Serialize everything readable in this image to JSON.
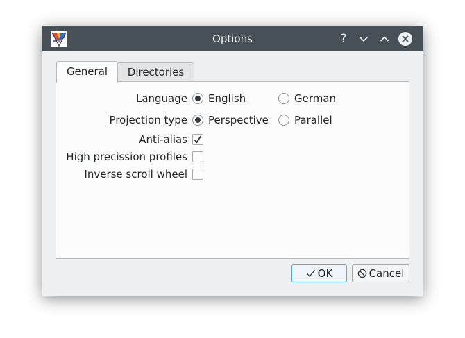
{
  "window": {
    "title": "Options"
  },
  "titlebar": {
    "help_label": "?",
    "icons": [
      "app-icon",
      "help-icon",
      "minimize-icon",
      "maximize-icon",
      "close-icon"
    ]
  },
  "tabs": [
    {
      "label": "General",
      "selected": true
    },
    {
      "label": "Directories",
      "selected": false
    }
  ],
  "general": {
    "language": {
      "label": "Language",
      "options": [
        "English",
        "German"
      ],
      "selected": "English"
    },
    "projection": {
      "label": "Projection type",
      "options": [
        "Perspective",
        "Parallel"
      ],
      "selected": "Perspective"
    },
    "checkboxes": [
      {
        "label": "Anti-alias",
        "checked": true
      },
      {
        "label": "High precission profiles",
        "checked": false
      },
      {
        "label": "Inverse scroll wheel",
        "checked": false
      }
    ]
  },
  "buttons": {
    "ok_label": "OK",
    "cancel_label": "Cancel"
  },
  "colors": {
    "titlebar": "#475057",
    "accent": "#3daee9",
    "window_bg": "#eff0f1"
  }
}
